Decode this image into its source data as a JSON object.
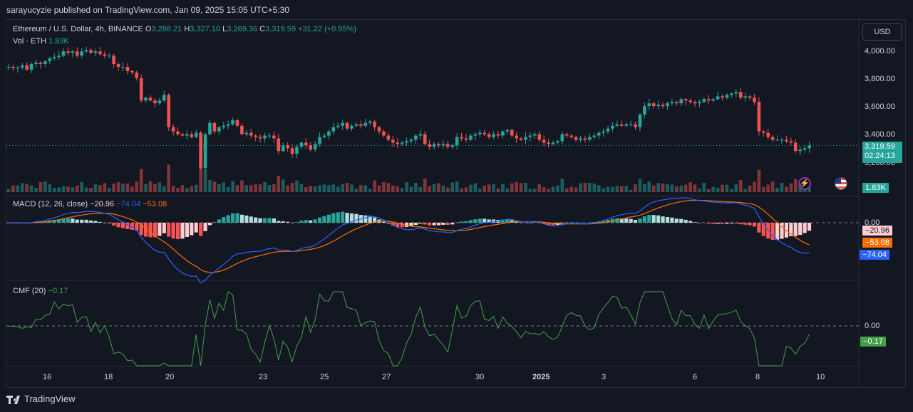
{
  "publisher": "sarayucyzie published on TradingView.com, Jan 09, 2025 15:05 UTC+5:30",
  "main": {
    "symbol": "Ethereum / U.S. Dollar, 4h, BINANCE",
    "o_label": "O",
    "o": "3,288.21",
    "h_label": "H",
    "h": "3,327.10",
    "l_label": "L",
    "l": "3,269.36",
    "c_label": "C",
    "c": "3,319.59",
    "change": "+31.22 (+0.95%)",
    "vol_label": "Vol · ETH",
    "vol_value": "1.83K",
    "currency": "USD",
    "price_badge": "3,319.59",
    "countdown": "02:24:13",
    "vol_badge": "1.83K",
    "price_ticks": [
      "4,000.00",
      "3,800.00",
      "3,600.00",
      "3,400.00",
      "3,200.00"
    ]
  },
  "macd": {
    "label": "MACD (12, 26, close)",
    "hist_value": "−20.96",
    "macd_value": "−74.04",
    "signal_value": "−53.08",
    "zero_tick": "0.00",
    "badge_hist": "−20.96",
    "badge_signal": "−53.08",
    "badge_macd": "−74.04"
  },
  "cmf": {
    "label": "CMF (20)",
    "value": "−0.17",
    "zero_tick": "0.00",
    "badge": "−0.17"
  },
  "time_ticks": [
    "16",
    "18",
    "20",
    "23",
    "25",
    "27",
    "30",
    "2025",
    "3",
    "6",
    "8",
    "10"
  ],
  "footer": {
    "brand": "TradingView"
  },
  "colors": {
    "up": "#26a69a",
    "down": "#ef5350",
    "macd": "#2962ff",
    "signal": "#ff6d00",
    "cmf": "#43a047",
    "bg": "#131722"
  },
  "icons": [
    "lightning-icon",
    "us-flag-icon",
    "tradingview-logo-icon"
  ],
  "chart_data": [
    {
      "type": "candlestick",
      "title": "Ethereum / U.S. Dollar, 4h, BINANCE",
      "ylim": [
        3100,
        4100
      ],
      "close": [
        3880,
        3870,
        3875,
        3890,
        3860,
        3900,
        3910,
        3900,
        3920,
        3940,
        3950,
        3960,
        3990,
        3980,
        3990,
        3960,
        3990,
        4000,
        3980,
        3990,
        3970,
        3960,
        3960,
        3900,
        3880,
        3880,
        3850,
        3840,
        3800,
        3640,
        3660,
        3640,
        3620,
        3640,
        3680,
        3450,
        3420,
        3400,
        3390,
        3400,
        3380,
        3410,
        3160,
        3400,
        3480,
        3420,
        3450,
        3460,
        3470,
        3500,
        3460,
        3400,
        3410,
        3390,
        3380,
        3370,
        3390,
        3390,
        3370,
        3280,
        3320,
        3300,
        3260,
        3310,
        3340,
        3320,
        3290,
        3330,
        3380,
        3390,
        3420,
        3450,
        3460,
        3480,
        3440,
        3460,
        3470,
        3460,
        3480,
        3490,
        3450,
        3420,
        3390,
        3360,
        3340,
        3330,
        3340,
        3350,
        3360,
        3390,
        3400,
        3330,
        3310,
        3330,
        3320,
        3330,
        3310,
        3320,
        3380,
        3370,
        3360,
        3390,
        3400,
        3410,
        3400,
        3380,
        3400,
        3390,
        3420,
        3430,
        3390,
        3370,
        3360,
        3380,
        3390,
        3400,
        3360,
        3340,
        3330,
        3340,
        3350,
        3400,
        3390,
        3380,
        3360,
        3370,
        3360,
        3380,
        3390,
        3410,
        3420,
        3440,
        3460,
        3470,
        3460,
        3470,
        3470,
        3450,
        3540,
        3600,
        3620,
        3600,
        3610,
        3600,
        3620,
        3630,
        3620,
        3650,
        3640,
        3630,
        3620,
        3630,
        3650,
        3640,
        3650,
        3670,
        3660,
        3680,
        3690,
        3700,
        3660,
        3670,
        3660,
        3630,
        3420,
        3410,
        3380,
        3360,
        3360,
        3360,
        3350,
        3340,
        3280,
        3290,
        3300,
        3320
      ],
      "volume_last": "1.83K"
    },
    {
      "type": "line",
      "title": "MACD (12, 26, close)",
      "series": [
        {
          "name": "MACD",
          "last": -74.04
        },
        {
          "name": "Signal",
          "last": -53.08
        },
        {
          "name": "Histogram",
          "last": -20.96
        }
      ]
    },
    {
      "type": "line",
      "title": "CMF (20)",
      "series": [
        {
          "name": "CMF",
          "last": -0.17
        }
      ]
    }
  ]
}
